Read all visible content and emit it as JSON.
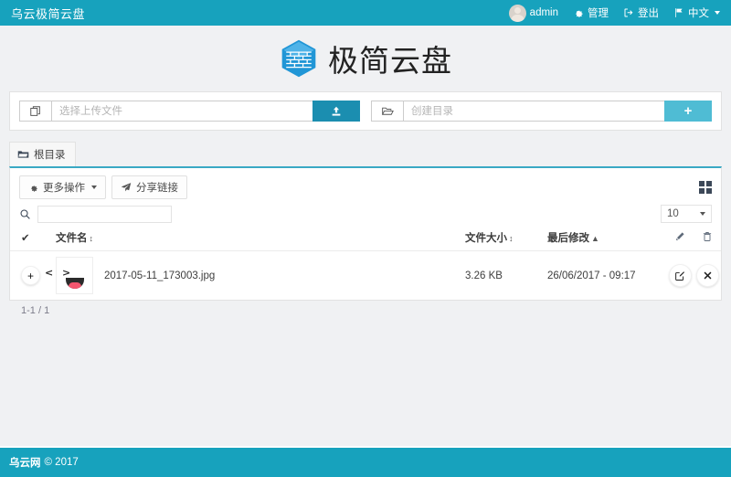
{
  "navbar": {
    "brand": "乌云极简云盘",
    "user": "admin",
    "admin_label": "管理",
    "logout_label": "登出",
    "lang_label": "中文",
    "bg_color": "#17a2bd"
  },
  "logo": {
    "text": "极简云盘",
    "icon": "cube-icon",
    "color": "#2196d6"
  },
  "upload": {
    "file_placeholder": "选择上传文件",
    "file_value": "",
    "upload_icon": "upload-icon",
    "files_icon": "files-icon",
    "folder_placeholder": "创建目录",
    "folder_value": "",
    "folder_icon": "folder-open-icon",
    "add_icon": "plus-icon",
    "upload_btn_color": "#1b8eb0",
    "create_btn_color": "#4fbcd4"
  },
  "breadcrumb": {
    "tab_label": "根目录",
    "icon": "folder-icon"
  },
  "toolbar": {
    "more_actions_label": "更多操作",
    "more_actions_icon": "gear-icon",
    "share_link_label": "分享链接",
    "share_link_icon": "paper-plane-icon",
    "grid_view_icon": "grid-view-icon"
  },
  "filter": {
    "search_placeholder": "",
    "search_value": "",
    "search_icon": "search-icon",
    "page_size": "10"
  },
  "table": {
    "headers": {
      "check": "✔",
      "name": "文件名",
      "size": "文件大小",
      "modified": "最后修改",
      "edit_icon": "pencil-icon",
      "delete_icon": "trash-icon"
    },
    "sort": {
      "name": "↕",
      "size": "↕",
      "modified": "▲"
    },
    "rows": [
      {
        "add_icon": "plus-icon",
        "thumb": "emoji-laughing-thumbnail",
        "name": "2017-05-11_173003.jpg",
        "size": "3.26 KB",
        "modified": "26/06/2017 - 09:17",
        "edit_icon": "edit-square-icon",
        "delete_icon": "close-icon"
      }
    ]
  },
  "pagination": {
    "info": "1-1 / 1"
  },
  "footer": {
    "brand": "乌云网",
    "copyright": "© 2017"
  }
}
